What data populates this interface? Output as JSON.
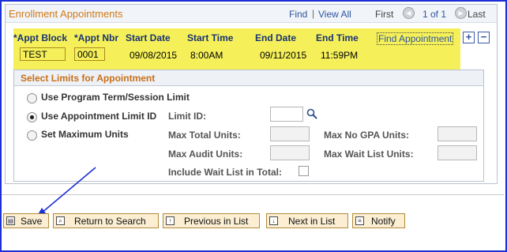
{
  "section": {
    "title": "Enrollment Appointments",
    "find": "Find",
    "separator": "|",
    "view_all": "View All",
    "first": "First",
    "range": "1 of 1",
    "last": "Last"
  },
  "appointment": {
    "block_label": "*Appt Block",
    "nbr_label": "*Appt Nbr",
    "start_date_label": "Start Date",
    "start_time_label": "Start Time",
    "end_date_label": "End Date",
    "end_time_label": "End Time",
    "block_value": "TEST",
    "nbr_value": "0001",
    "start_date": "09/08/2015",
    "start_time": "8:00AM",
    "end_date": "09/11/2015",
    "end_time": "11:59PM",
    "find_appointment": "Find Appointment",
    "add_symbol": "+",
    "remove_symbol": "−"
  },
  "limits": {
    "title": "Select Limits for Appointment",
    "options": [
      {
        "label": "Use Program Term/Session Limit",
        "checked": false
      },
      {
        "label": "Use Appointment Limit ID",
        "checked": true
      },
      {
        "label": "Set Maximum Units",
        "checked": false
      }
    ],
    "limit_id_label": "Limit ID:",
    "max_total_units_label": "Max Total Units:",
    "max_no_gpa_units_label": "Max No GPA Units:",
    "max_audit_units_label": "Max Audit Units:",
    "max_wait_list_units_label": "Max Wait List Units:",
    "include_wait_list_label": "Include Wait List in Total:"
  },
  "toolbar": {
    "save": "Save",
    "return_to_search": "Return to Search",
    "previous_in_list": "Previous in List",
    "next_in_list": "Next in List",
    "notify": "Notify"
  },
  "icons": {
    "search": "search-icon",
    "prev_arrow": "arrow-left-icon",
    "next_arrow": "arrow-right-icon"
  },
  "colors": {
    "frame_border": "#1a2fd6",
    "highlight": "#f5f05a",
    "section_title": "#d07a18",
    "link": "#2c55a0",
    "button_bg": "#fbeed2",
    "annotation_arrow": "#1a2fd6"
  }
}
